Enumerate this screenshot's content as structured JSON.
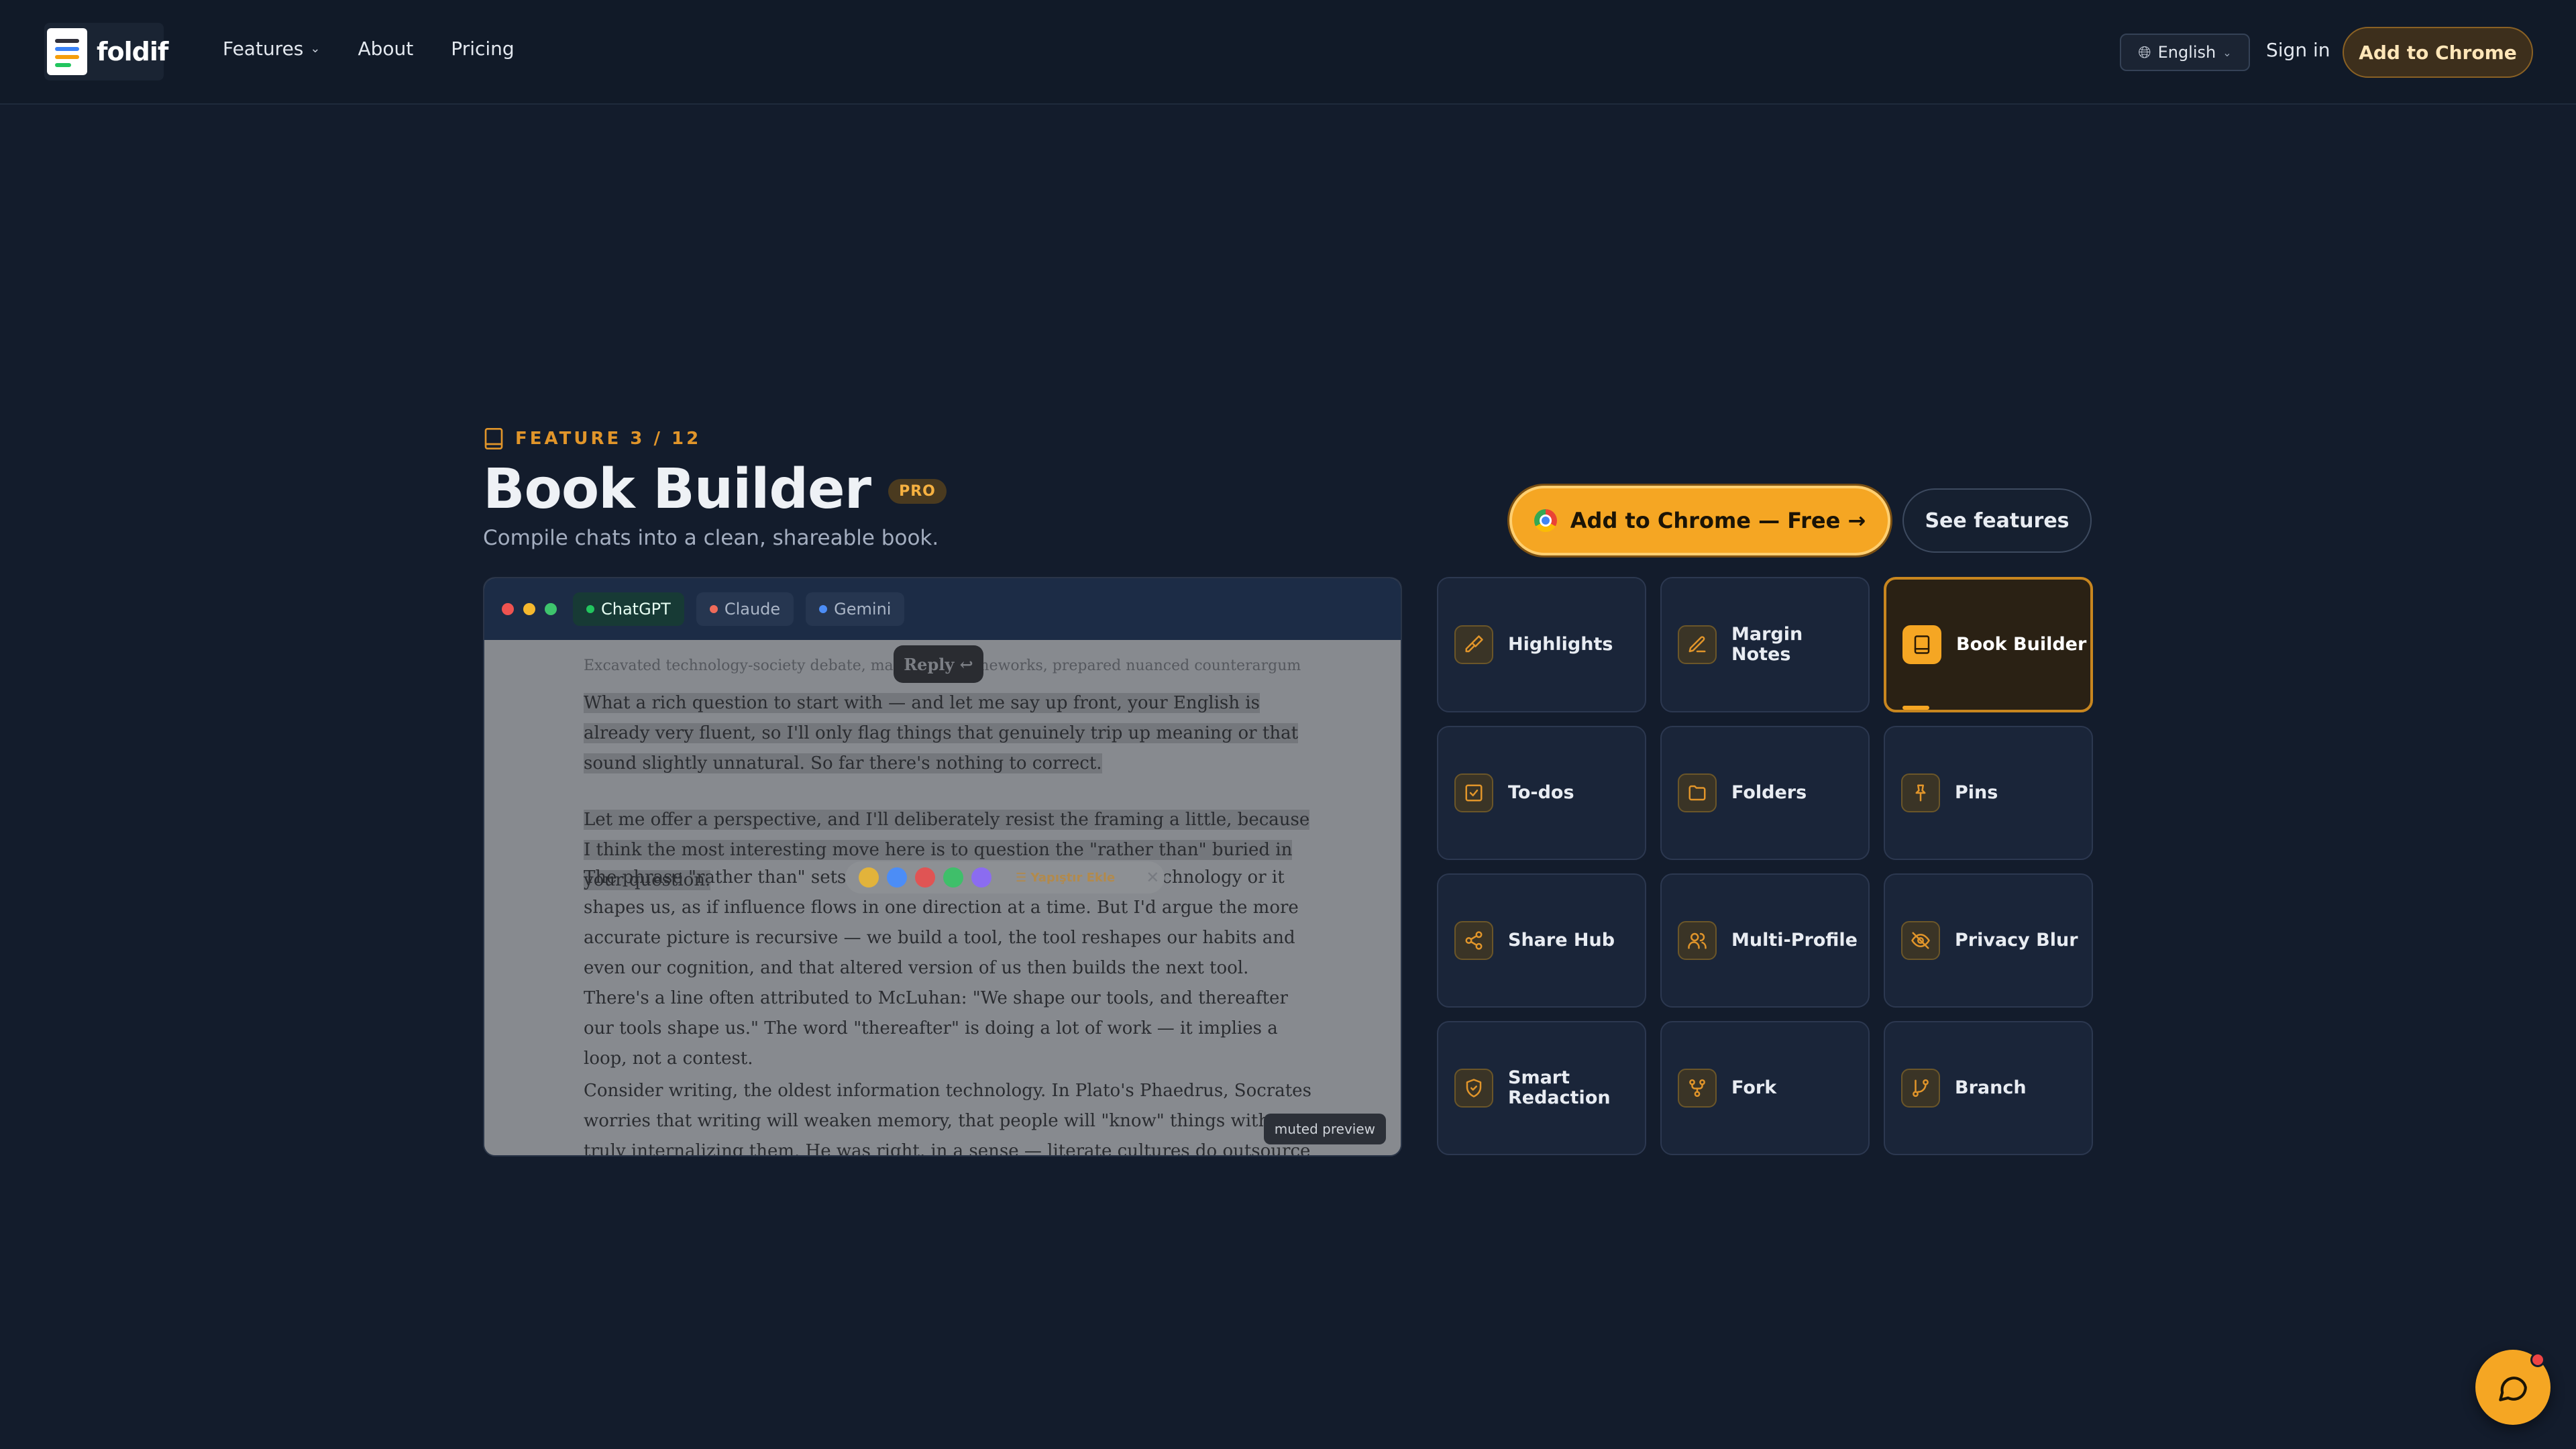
{
  "nav": {
    "logo_text": "foldif",
    "links": [
      {
        "label": "Features",
        "has_dropdown": true
      },
      {
        "label": "About"
      },
      {
        "label": "Pricing"
      }
    ],
    "language": "English",
    "sign_in": "Sign in",
    "cta": "Add to Chrome"
  },
  "feature": {
    "eyebrow": "FEATURE 3 / 12",
    "title": "Book Builder",
    "badge": "PRO",
    "subtitle": "Compile chats into a clean, shareable book.",
    "cta_primary": "Add to Chrome — Free →",
    "cta_secondary": "See features"
  },
  "preview": {
    "tabs": [
      {
        "label": "ChatGPT",
        "color": "#22c55e",
        "active": true
      },
      {
        "label": "Claude",
        "color": "#ef6b5a"
      },
      {
        "label": "Gemini",
        "color": "#4c8df6"
      }
    ],
    "breadcrumb": "Excavated technology-society debate, marshaled frameworks, prepared nuanced counterargument  ›",
    "reply_label": "Reply ↩",
    "toolbar_label": "☰ Yapıştır Ekle",
    "toolbar_close": "✕",
    "para1": "What a rich question to start with — and let me say up front, your English is already very fluent, so I'll only flag things that genuinely trip up meaning or that sound slightly unnatural. So far there's nothing to correct.",
    "para2": "Let me offer a perspective, and I'll deliberately resist the framing a little, because I think the most interesting move here is to question the \"rather than\" buried in your question.",
    "para3": "The phrase \"rather than\" sets up the idea that either we shape technology or it shapes us, as if influence flows in one direction at a time. But I'd argue the more accurate picture is recursive — we build a tool, the tool reshapes our habits and even our cognition, and that altered version of us then builds the next tool. There's a line often attributed to McLuhan: \"We shape our tools, and thereafter our tools shape us.\" The word \"thereafter\" is doing a lot of work — it implies a loop, not a contest.",
    "para4": "Consider writing, the oldest information technology. In Plato's Phaedrus, Socrates worries that writing will weaken memory, that people will \"know\" things without truly internalizing them. He was right, in a sense — literate cultures do outsource memory to the page. But",
    "muted_label": "muted preview",
    "swatches": [
      "#e2b33b",
      "#4c8df6",
      "#e05454",
      "#3fbf6a",
      "#8b6cf0"
    ]
  },
  "features_grid": [
    {
      "label": "Highlights",
      "icon": "highlighter-icon"
    },
    {
      "label": "Margin Notes",
      "icon": "pencil-icon"
    },
    {
      "label": "Book Builder",
      "icon": "book-icon",
      "active": true
    },
    {
      "label": "To-dos",
      "icon": "checkbox-icon"
    },
    {
      "label": "Folders",
      "icon": "folder-icon"
    },
    {
      "label": "Pins",
      "icon": "pin-icon"
    },
    {
      "label": "Share Hub",
      "icon": "share-icon"
    },
    {
      "label": "Multi-Profile",
      "icon": "users-icon"
    },
    {
      "label": "Privacy Blur",
      "icon": "eye-off-icon"
    },
    {
      "label": "Smart Redaction",
      "icon": "shield-check-icon"
    },
    {
      "label": "Fork",
      "icon": "fork-icon"
    },
    {
      "label": "Branch",
      "icon": "branch-icon"
    }
  ],
  "colors": {
    "accent": "#f5a623",
    "background": "#131c2c",
    "card": "#1a2539"
  }
}
